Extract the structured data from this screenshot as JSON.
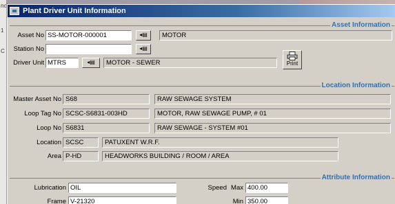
{
  "window": {
    "title": "Plant Driver Unit Information"
  },
  "sections": {
    "asset": "Asset Information",
    "location": "Location Information",
    "attribute": "Attribute Information"
  },
  "asset": {
    "asset_no_label": "Asset No",
    "asset_no": "SS-MOTOR-000001",
    "asset_desc": "MOTOR",
    "station_no_label": "Station No",
    "station_no": "",
    "driver_unit_label": "Driver Unit",
    "driver_unit": "MTRS",
    "driver_unit_desc": "MOTOR - SEWER",
    "print_label": "Print"
  },
  "location": {
    "master_asset_label": "Master Asset No",
    "master_asset": "S68",
    "master_asset_desc": "RAW SEWAGE SYSTEM",
    "loop_tag_label": "Loop Tag No",
    "loop_tag": "SCSC-S6831-003HD",
    "loop_tag_desc": "MOTOR, RAW SEWAGE PUMP, # 01",
    "loop_no_label": "Loop No",
    "loop_no": "S6831",
    "loop_no_desc": "RAW SEWAGE - SYSTEM #01",
    "location_label": "Location",
    "location": "SCSC",
    "location_desc": "PATUXENT W.R.F.",
    "area_label": "Area",
    "area": "P-HD",
    "area_desc": "HEADWORKS BUILDING / ROOM / AREA"
  },
  "attribute": {
    "lubrication_label": "Lubrication",
    "lubrication": "OIL",
    "frame_label": "Frame",
    "frame": "V-21320",
    "speed_label": "Speed",
    "max_label": "Max",
    "speed_max": "400.00",
    "min_label": "Min",
    "speed_min": "350.00"
  },
  "background": {
    "fragments": [
      "ncl",
      "1",
      "C"
    ]
  },
  "icons": {
    "lookup": "lookup-list-icon",
    "print": "printer-icon",
    "app": "app-icon"
  }
}
